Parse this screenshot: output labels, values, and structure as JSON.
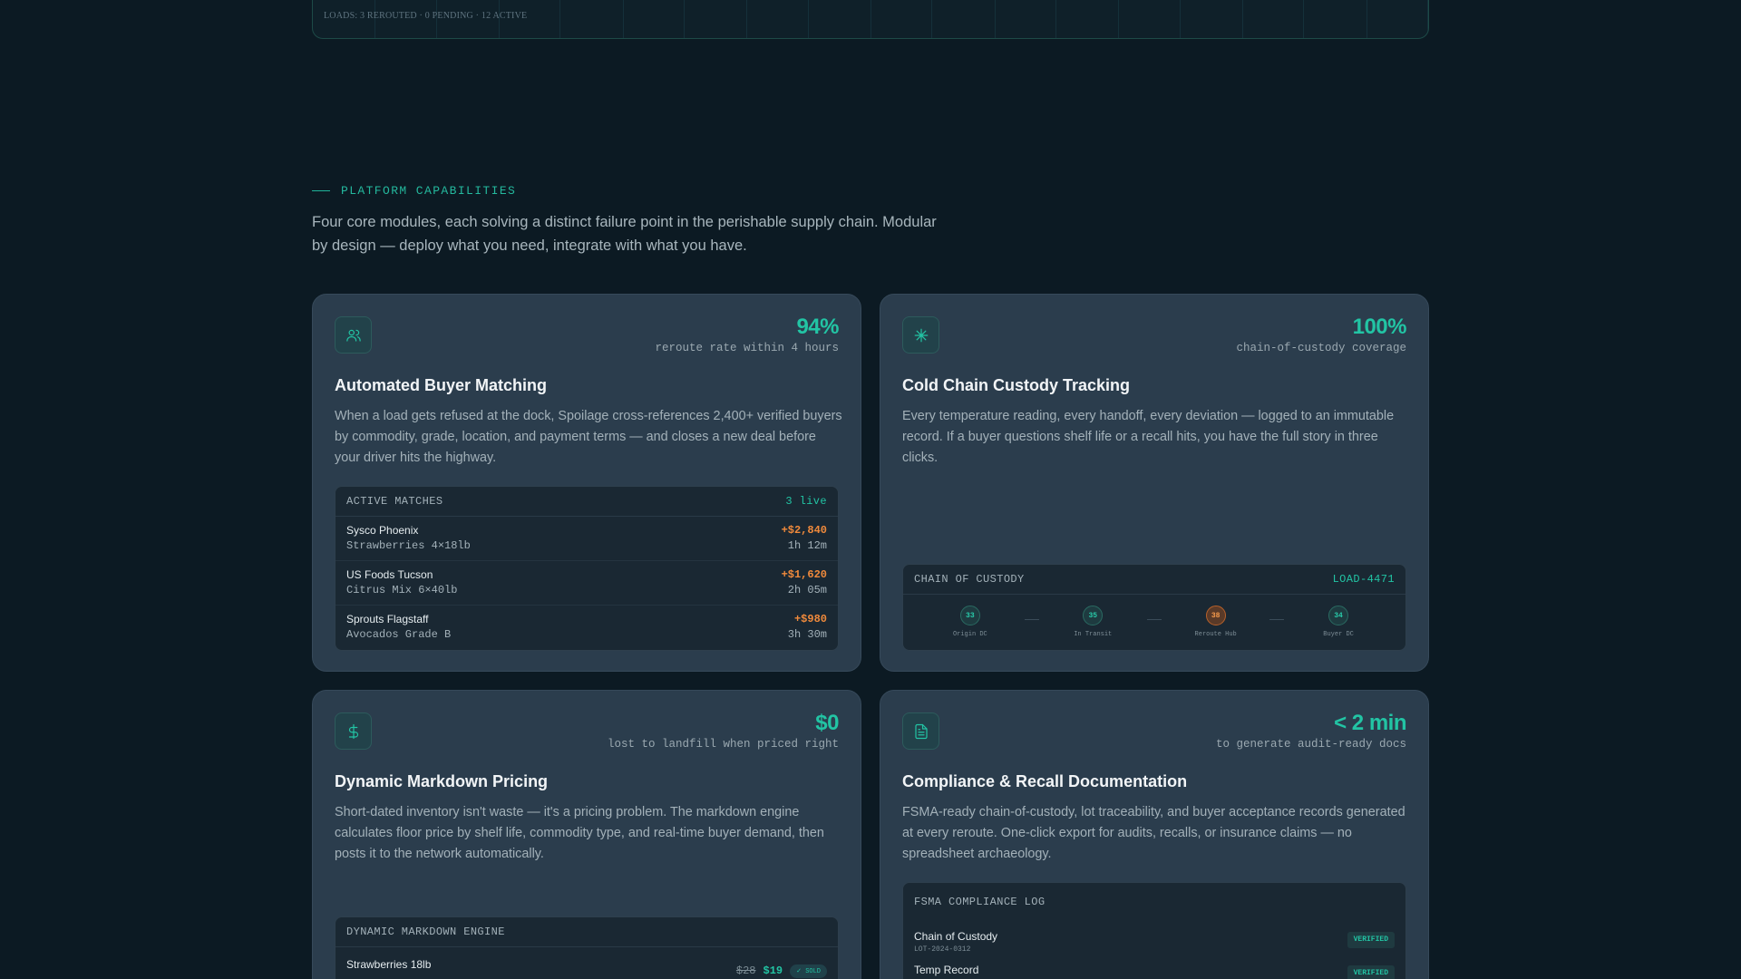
{
  "top_panel": {
    "loads": "LOADS: 3 REROUTED · 0 PENDING · 12 ACTIVE"
  },
  "section": {
    "eyebrow": "PLATFORM CAPABILITIES",
    "intro": "Four core modules, each solving a distinct failure point in the perishable supply chain. Modular by design — deploy what you need, integrate with what you have."
  },
  "cards": [
    {
      "icon": "users-icon",
      "stat_value": "94%",
      "stat_label": "reroute rate within 4 hours",
      "title": "Automated Buyer Matching",
      "description": "When a load gets refused at the dock, Spoilage cross-references 2,400+ verified buyers by commodity, grade, location, and payment terms — and closes a new deal before your driver hits the highway.",
      "widget": {
        "title": "ACTIVE MATCHES",
        "tag": "3 live",
        "rows": [
          {
            "buyer": "Sysco Phoenix",
            "product": "Strawberries 4×18lb",
            "amount": "+$2,840",
            "time": "1h 12m"
          },
          {
            "buyer": "US Foods Tucson",
            "product": "Citrus Mix 6×40lb",
            "amount": "+$1,620",
            "time": "2h 05m"
          },
          {
            "buyer": "Sprouts Flagstaff",
            "product": "Avocados Grade B",
            "amount": "+$980",
            "time": "3h 30m"
          }
        ]
      }
    },
    {
      "icon": "snowflake-icon",
      "stat_value": "100%",
      "stat_label": "chain-of-custody coverage",
      "title": "Cold Chain Custody Tracking",
      "description": "Every temperature reading, every handoff, every deviation — logged to an immutable record. If a buyer questions shelf life or a recall hits, you have the full story in three clicks.",
      "widget": {
        "title": "CHAIN OF CUSTODY",
        "tag": "LOAD-4471",
        "nodes": [
          {
            "temp": "33",
            "label": "Origin DC",
            "warn": false
          },
          {
            "temp": "35",
            "label": "In Transit",
            "warn": false
          },
          {
            "temp": "38",
            "label": "Reroute Hub",
            "warn": true
          },
          {
            "temp": "34",
            "label": "Buyer DC",
            "warn": false
          }
        ]
      }
    },
    {
      "icon": "dollar-icon",
      "stat_value": "$0",
      "stat_label": "lost to landfill when priced right",
      "title": "Dynamic Markdown Pricing",
      "description": "Short-dated inventory isn't waste — it's a pricing problem. The markdown engine calculates floor price by shelf life, commodity type, and real-time buyer demand, then posts it to the network automatically.",
      "widget": {
        "title": "DYNAMIC MARKDOWN ENGINE",
        "rows": [
          {
            "item": "Strawberries 18lb",
            "old_price": "$28",
            "new_price": "$19",
            "badge": "✓ SOLD"
          }
        ]
      }
    },
    {
      "icon": "document-icon",
      "stat_value": "< 2 min",
      "stat_label": "to generate audit-ready docs",
      "title": "Compliance & Recall Documentation",
      "description": "FSMA-ready chain-of-custody, lot traceability, and buyer acceptance records generated at every reroute. One-click export for audits, recalls, or insurance claims — no spreadsheet archaeology.",
      "widget": {
        "title": "FSMA COMPLIANCE LOG",
        "rows": [
          {
            "name": "Chain of Custody",
            "id": "LOT-2024-0312",
            "status": "VERIFIED"
          },
          {
            "name": "Temp Record",
            "id": "",
            "status": "VERIFIED"
          }
        ]
      }
    }
  ]
}
